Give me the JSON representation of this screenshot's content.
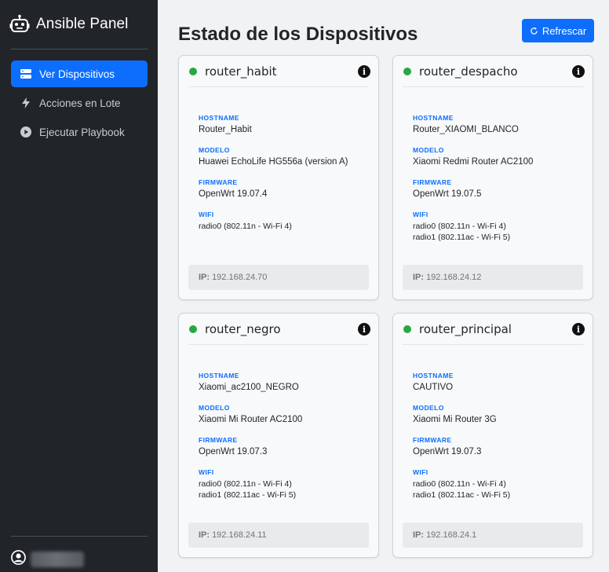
{
  "app": {
    "title": "Ansible Panel"
  },
  "sidebar": {
    "items": [
      {
        "label": "Ver Dispositivos",
        "icon": "server-icon",
        "active": true
      },
      {
        "label": "Acciones en Lote",
        "icon": "lightning-icon",
        "active": false
      },
      {
        "label": "Ejecutar Playbook",
        "icon": "play-circle-icon",
        "active": false
      }
    ]
  },
  "main": {
    "title": "Estado de los Dispositivos",
    "refresh_label": "Refrescar"
  },
  "labels": {
    "hostname": "HOSTNAME",
    "modelo": "MODELO",
    "firmware": "FIRMWARE",
    "wifi": "WIFI",
    "ip": "IP:"
  },
  "devices": [
    {
      "name": "router_habit",
      "status": "online",
      "hostname": "Router_Habit",
      "modelo": "Huawei EchoLife HG556a (version A)",
      "firmware": "OpenWrt 19.07.4",
      "wifi": [
        "radio0 (802.11n - Wi-Fi 4)"
      ],
      "ip": "192.168.24.70"
    },
    {
      "name": "router_despacho",
      "status": "online",
      "hostname": "Router_XIAOMI_BLANCO",
      "modelo": "Xiaomi Redmi Router AC2100",
      "firmware": "OpenWrt 19.07.5",
      "wifi": [
        "radio0 (802.11n - Wi-Fi 4)",
        "radio1 (802.11ac - Wi-Fi 5)"
      ],
      "ip": "192.168.24.12"
    },
    {
      "name": "router_negro",
      "status": "online",
      "hostname": "Xiaomi_ac2100_NEGRO",
      "modelo": "Xiaomi Mi Router AC2100",
      "firmware": "OpenWrt 19.07.3",
      "wifi": [
        "radio0 (802.11n - Wi-Fi 4)",
        "radio1 (802.11ac - Wi-Fi 5)"
      ],
      "ip": "192.168.24.11"
    },
    {
      "name": "router_principal",
      "status": "online",
      "hostname": "CAUTIVO",
      "modelo": "Xiaomi Mi Router 3G",
      "firmware": "OpenWrt 19.07.3",
      "wifi": [
        "radio0 (802.11n - Wi-Fi 4)",
        "radio1 (802.11ac - Wi-Fi 5)"
      ],
      "ip": "192.168.24.1"
    }
  ],
  "colors": {
    "accent": "#0d6efd",
    "sidebar_bg": "#212529",
    "status_online": "#28a745"
  }
}
